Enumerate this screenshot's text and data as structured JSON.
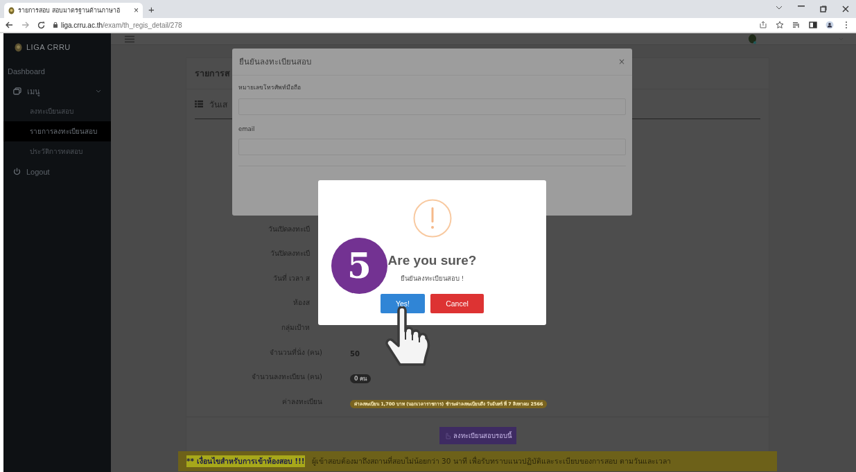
{
  "browser": {
    "tab_title": "รายการสอบ สอบมาตรฐานด้านภาษาอั",
    "tab_close": "×",
    "new_tab": "+",
    "url_host": "liga.crru.ac.th",
    "url_path": "/exam/th_regis_detail/278"
  },
  "sidebar": {
    "brand": "LIGA CRRU",
    "items": [
      {
        "label": "Dashboard",
        "kind": "link",
        "selected": false
      },
      {
        "label": "เมนู",
        "kind": "group",
        "expanded": true,
        "children": [
          {
            "label": "ลงทะเบียนสอบ",
            "selected": false
          },
          {
            "label": "รายการลงทะเบียนสอบ",
            "selected": true
          },
          {
            "label": "ประวัติการทดสอบ",
            "selected": false
          }
        ]
      },
      {
        "label": "Logout",
        "kind": "logout",
        "selected": false
      }
    ]
  },
  "page": {
    "card_title": "รายการส",
    "section_title": "วันเส",
    "rows": [
      {
        "label": "วันเปิดลงทะเบี",
        "kind": "partial"
      },
      {
        "label": "วันปิดลงทะเบี",
        "kind": "partial"
      },
      {
        "label": "วันที่ เวลา ส",
        "kind": "partial"
      },
      {
        "label": "ห้องส",
        "kind": "partial"
      },
      {
        "label": "กลุ่มเป้าห",
        "kind": "partial"
      },
      {
        "label": "จำนวนที่นั่ง (คน)",
        "kind": "text",
        "value": "50"
      },
      {
        "label": "จำนวนลงทะเบียน (คน)",
        "kind": "badge",
        "value": "0 คน"
      },
      {
        "label": "ค่าลงทะเบียน",
        "kind": "fee",
        "value": "ค่าลงทะเบียน 1,700 บาท (นอกเวลาราชการ) ชำระค่าลงทะเบียนถึง วันจันทร์ ที่ 7 สิงหาคม 2566"
      }
    ],
    "register_button": "ลงทะเบียนสอบรอบนี้",
    "notice_title": "** เงื่อนไขสำหรับการเข้าห้องสอบ !!!",
    "notice_text": "ผู้เข้าสอบต้องมาถึงสถานที่สอบไม่น้อยกว่า 30 นาที เพื่อรับทราบแนวปฏิบัติและระเบียบของการสอบ ตามวันและเวลา"
  },
  "form_modal": {
    "title": "ยืนยันลงทะเบียนสอบ",
    "close": "×",
    "fields": [
      {
        "label": "หมายเลขโทรศัพท์มือถือ"
      },
      {
        "label": "email"
      }
    ]
  },
  "alert": {
    "title": "Are you sure?",
    "text": "ยืนยันลงทะเบียนสอบ !",
    "confirm": "Yes!",
    "cancel": "Cancel"
  },
  "step_badge": "5"
}
